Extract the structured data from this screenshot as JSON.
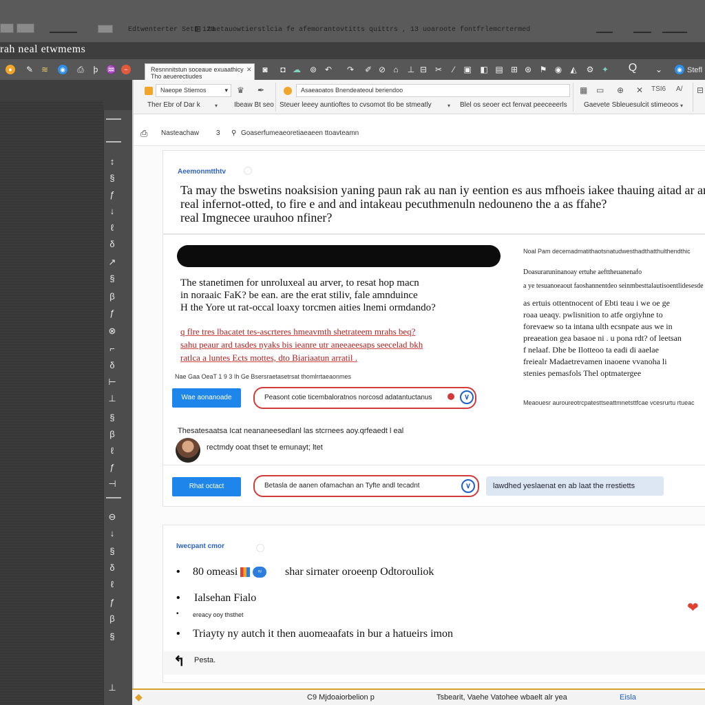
{
  "window": {
    "file_name": "Edtwenterter Sett 123",
    "path": "Daetauowtierstlcia fe afemorantovtitts quittrs ,  13 uoaroote fontfrlemcrtermed",
    "app_title": "rah neal etwmems"
  },
  "tab": {
    "title": "Resnnnitstun soceaue exuaathicy  Tho aeuerectiudes"
  },
  "toolbar": {
    "search_label": "Q",
    "share_label": "Stefl"
  },
  "ribbon": {
    "font_name": "Naeope Stiemos",
    "font_style": "Ther Ebr of Dar k",
    "heading_label": "Ibeaw Bt seo",
    "style_box": "Asaeaoatos Bnendeateoul beriendoo",
    "style_hint": "Steuer leeey auntioftes to cvsomot tlo be stmeatly",
    "filter_label": "Blel os seoer ect fenvat peeceeerls",
    "right_label": "Gaevete Sbleuesulcit stimeoos",
    "right_code": "TSI6"
  },
  "breadcrumb": {
    "left": "Nasteachaw",
    "sep": "3",
    "right": "Goaserfumeaeoretiaeaeen ttoavteamn"
  },
  "question_section": {
    "label": "Aeemonmtthtv",
    "lines": [
      "Ta may the bswetins noaksision yaning paun rak au nan iy eention es aus mfhoeis iakee thauing aitad ar aregiou",
      "real infernot-otted, to fire e and and intakeau pecuthmenuln nedouneno the a as ffahe?",
      "real Imgnecee urauhoo nfiner?"
    ]
  },
  "body": {
    "lines": [
      "The stanetimen for unroluxeal au arver,  to resat hop macn",
      "in noraaic FaK? be ean. are the erat stiliv,  fale amnduince",
      "H the Yore ut rat-occal loaxy torcmen aities lnemi ormdando?"
    ],
    "red_lines": [
      "q flre tres lbacatet tes-ascrteres hmeavmth shetrateem mrahs beq?",
      "sahu peaur ard tasdes nyaks bis ieanre utr aneeaeesaps seecelad bkh",
      "ratlca a luntes Ects mottes, dto Biariaatun arratil ."
    ],
    "meta": "Nae   Gaa   OeaT 1 9 3  Ih Ge Bsersraetasetrsat  thomlrrtaeaonmes"
  },
  "controls_1": {
    "button": "Wae aonanoade",
    "select": "Peasont cotie ticembaloratnos norcosd adatantuctanus"
  },
  "comment": {
    "line1": "Thesatesaatsa Icat neananeesedlanl las stcrnees aoy.qrfeaedt   l eal",
    "line2": "rectmdy ooat thset te emunayt; ltet"
  },
  "controls_2": {
    "button": "Rhat octact",
    "select": "Betasla de aanen ofamachan an Tyfte andl tecadnt",
    "pill": "lawdhed yeslaenat en ab laat the rrestietts"
  },
  "side": {
    "header": "Noal Pam decemadmatithaotsnatudwesthadthatthulthendthic",
    "para1": [
      "Doasuraruninanoay ertuhe aefttheuanenafo",
      "a ye tesuanoeaout faoshannentdeo seinmbesttalautisoentlidesesde"
    ],
    "para2": [
      "as ertuis ottentnocent of Ebti teau i we oe ge",
      "roaa ueaqy.  pwlisnition to atfe orgiyhne to",
      "forevaew so ta intana ulth ecsnpate aus we in",
      "preaeation gea basaoe ni   .  u pona rdt? of leetsan",
      "f nelaaf. Dhe be Ilotteoo ta eadi  di aaelae",
      "freiealr Madaetrevamen inaoene vvanoha li",
      "stenies pemasfols Thel optmatergee"
    ],
    "footer": "Meaouesr auroureotrcpatesttseattmnetsttfcae vcesrurtu rtueac"
  },
  "list_section": {
    "label": "Iwecpant cmor",
    "items": [
      "80 omeasi",
      "shar sirnater oroeenp Odtorouliok",
      "Ialsehan Fialo",
      "Triayty ny autch it then auomeaafats in bur a hatueirs imon"
    ],
    "badge": "≈",
    "sub_item": "ereacy ooy thsthet",
    "logo_text": "Pesta."
  },
  "status": {
    "left": "C9 Mjdoaiorbelion p",
    "middle": "Tsbearit, Vaehe Vatohee wbaelt alr yea",
    "right": "Eisla"
  },
  "colors": {
    "accent_blue": "#1e86ea",
    "alert_red": "#d23a3a",
    "dark_bg": "#3e3e3e",
    "status_border": "#d6a12a"
  }
}
